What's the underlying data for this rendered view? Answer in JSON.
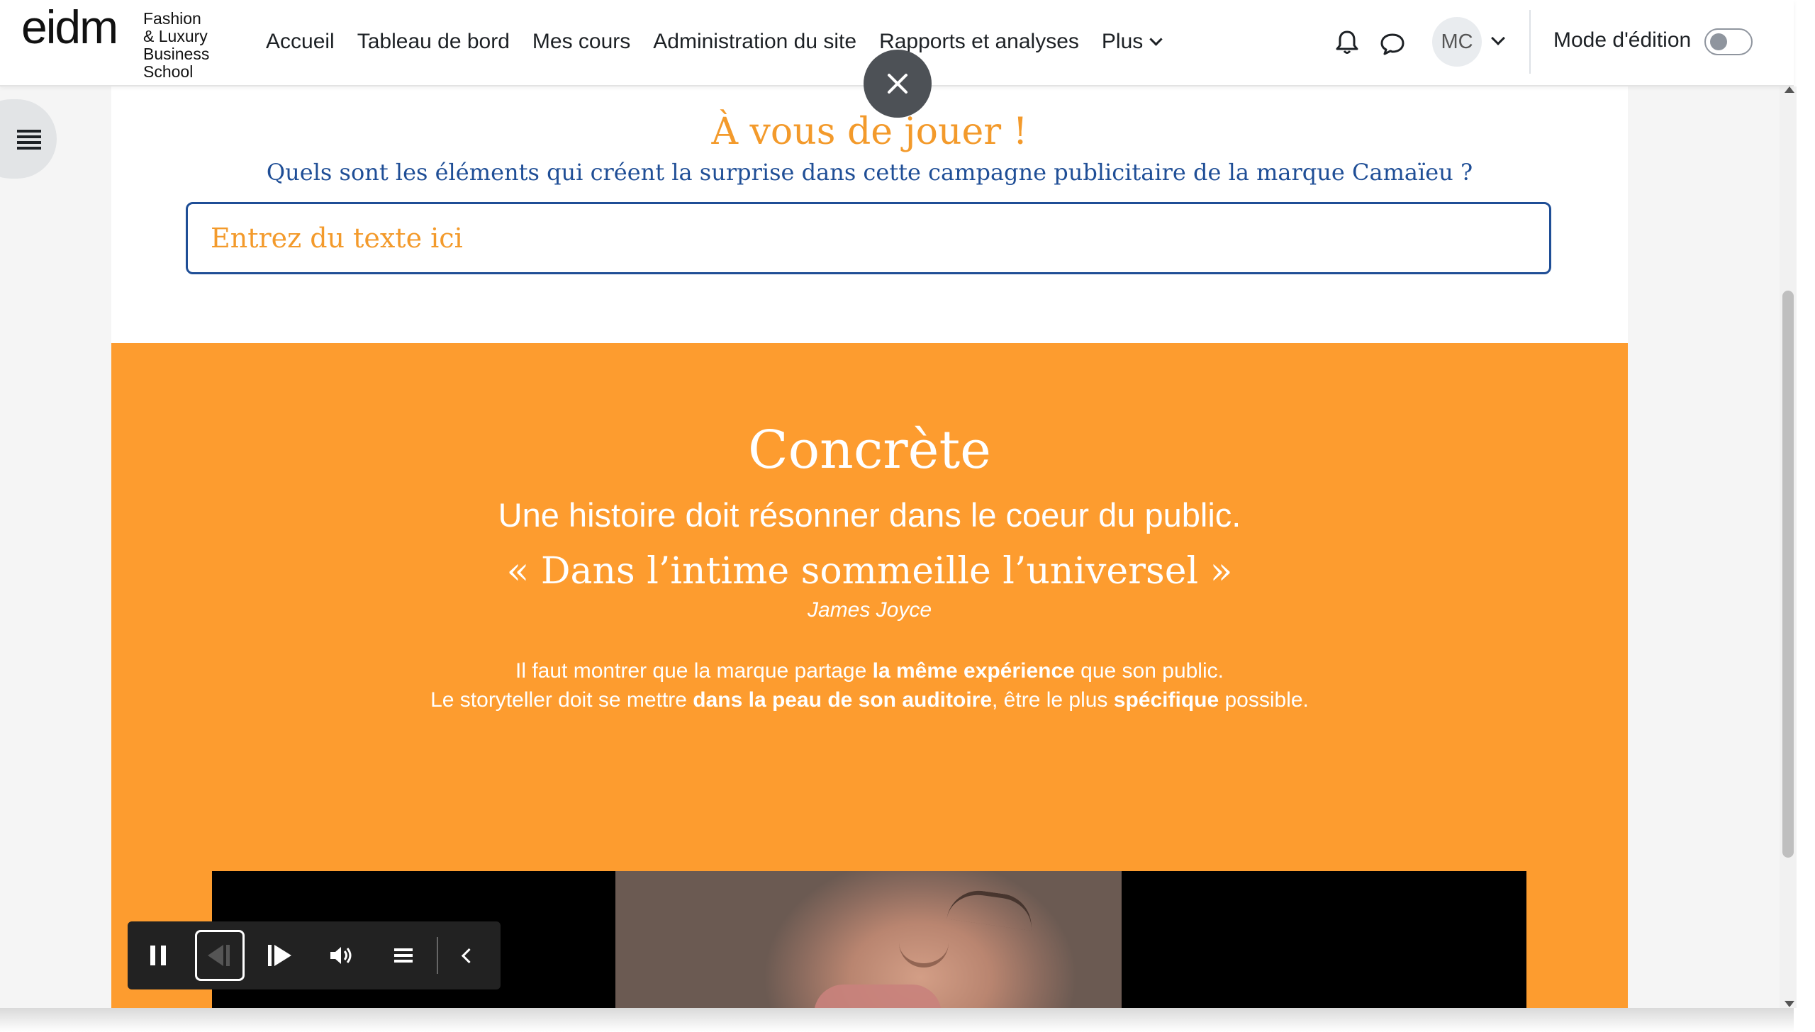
{
  "logo": {
    "mark": "eidm",
    "sub_lines": [
      "Fashion",
      "& Luxury",
      "Business",
      "School"
    ]
  },
  "nav": {
    "items": [
      {
        "label": "Accueil"
      },
      {
        "label": "Tableau de bord"
      },
      {
        "label": "Mes cours"
      },
      {
        "label": "Administration du site"
      },
      {
        "label": "Rapports et analyses"
      }
    ],
    "more_label": "Plus"
  },
  "user": {
    "initials": "MC",
    "edit_mode_label": "Mode d'édition",
    "edit_mode_on": false
  },
  "activity": {
    "title": "À vous de jouer !",
    "question": "Quels sont les éléments qui créent la surprise dans cette campagne publicitaire de la marque Camaïeu ?",
    "input_placeholder": "Entrez du texte ici"
  },
  "slide": {
    "title": "Concrète",
    "subtitle": "Une histoire doit résonner dans le coeur du public.",
    "quote": "« Dans l’intime sommeille l’universel »",
    "author": "James Joyce",
    "body": {
      "line1_a": "Il faut montrer que la marque partage ",
      "line1_b": "la même expérience",
      "line1_c": " que son public.",
      "line2_a": "Le storyteller doit se mettre ",
      "line2_b": "dans la peau de son auditoire",
      "line2_c": ", être le plus ",
      "line2_d": "spécifique",
      "line2_e": " possible."
    },
    "background_color": "#fd9c2f"
  },
  "colors": {
    "accent_orange": "#f39a2b",
    "accent_blue": "#1f4e96"
  }
}
